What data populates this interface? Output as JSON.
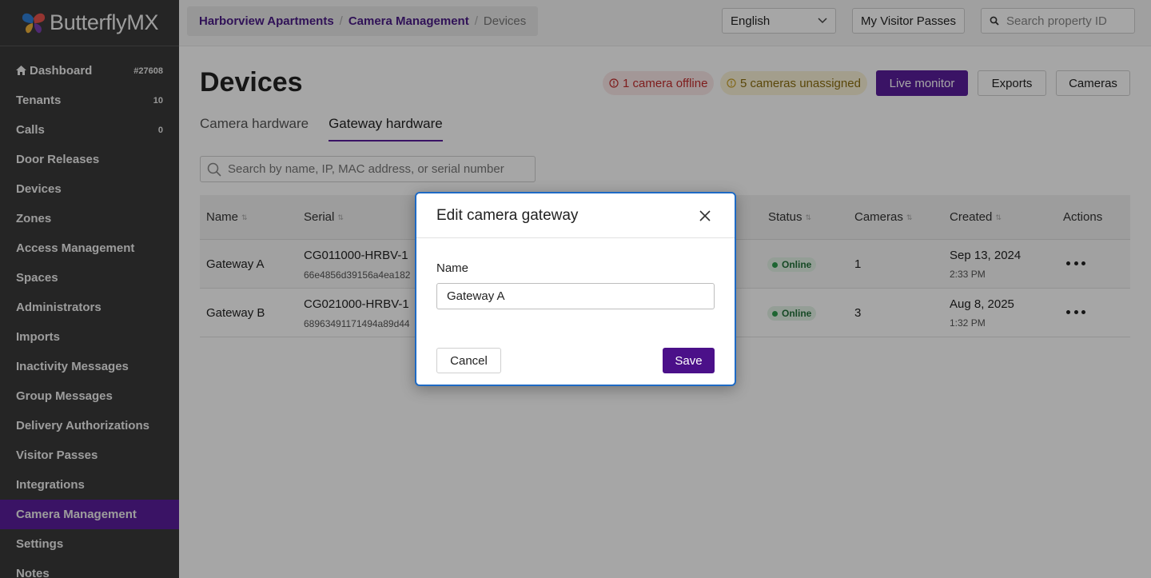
{
  "brand": {
    "name": "ButterflyMX"
  },
  "sidebar": {
    "items": [
      {
        "label": "Dashboard",
        "badge": "#27608",
        "icon": "home-icon"
      },
      {
        "label": "Tenants",
        "badge": "10"
      },
      {
        "label": "Calls",
        "badge": "0"
      },
      {
        "label": "Door Releases",
        "badge": ""
      },
      {
        "label": "Devices",
        "badge": ""
      },
      {
        "label": "Zones",
        "badge": ""
      },
      {
        "label": "Access Management",
        "badge": ""
      },
      {
        "label": "Spaces",
        "badge": ""
      },
      {
        "label": "Administrators",
        "badge": ""
      },
      {
        "label": "Imports",
        "badge": ""
      },
      {
        "label": "Inactivity Messages",
        "badge": ""
      },
      {
        "label": "Group Messages",
        "badge": ""
      },
      {
        "label": "Delivery Authorizations",
        "badge": ""
      },
      {
        "label": "Visitor Passes",
        "badge": ""
      },
      {
        "label": "Integrations",
        "badge": ""
      },
      {
        "label": "Camera Management",
        "badge": "",
        "active": true
      },
      {
        "label": "Settings",
        "badge": ""
      },
      {
        "label": "Notes",
        "badge": ""
      }
    ]
  },
  "topbar": {
    "breadcrumb": [
      "Harborview Apartments",
      "Camera Management",
      "Devices"
    ],
    "language": "English",
    "visitor_passes": "My Visitor Passes",
    "search_placeholder": "Search property ID"
  },
  "page": {
    "title": "Devices",
    "offline_alert": "1 camera offline",
    "unassigned_alert": "5 cameras unassigned",
    "live_monitor": "Live monitor",
    "exports": "Exports",
    "cameras": "Cameras",
    "tabs": [
      "Camera hardware",
      "Gateway hardware"
    ],
    "active_tab": 1,
    "search_placeholder": "Search by name, IP, MAC address, or serial number"
  },
  "table": {
    "columns": [
      "Name",
      "Serial",
      "Status",
      "Cameras",
      "Created",
      "Actions"
    ],
    "rows": [
      {
        "name": "Gateway A",
        "serial": "CG011000-HRBV-1",
        "serial_sub": "66e4856d39156a4ea182",
        "status": "Online",
        "cameras": "1",
        "created_date": "Sep 13, 2024",
        "created_time": "2:33 PM"
      },
      {
        "name": "Gateway B",
        "serial": "CG021000-HRBV-1",
        "serial_sub": "68963491171494a89d44",
        "status": "Online",
        "cameras": "3",
        "created_date": "Aug 8, 2025",
        "created_time": "1:32 PM"
      }
    ]
  },
  "modal": {
    "title": "Edit camera gateway",
    "name_label": "Name",
    "name_value": "Gateway A",
    "cancel": "Cancel",
    "save": "Save"
  },
  "colors": {
    "brand_purple": "#5a1e9b",
    "sidebar_bg": "#3a3a3a",
    "modal_border": "#1e6ac4",
    "offline_red": "#c22d2d",
    "unassigned_amber": "#8a6d0f",
    "online_green": "#2e9d4d"
  }
}
